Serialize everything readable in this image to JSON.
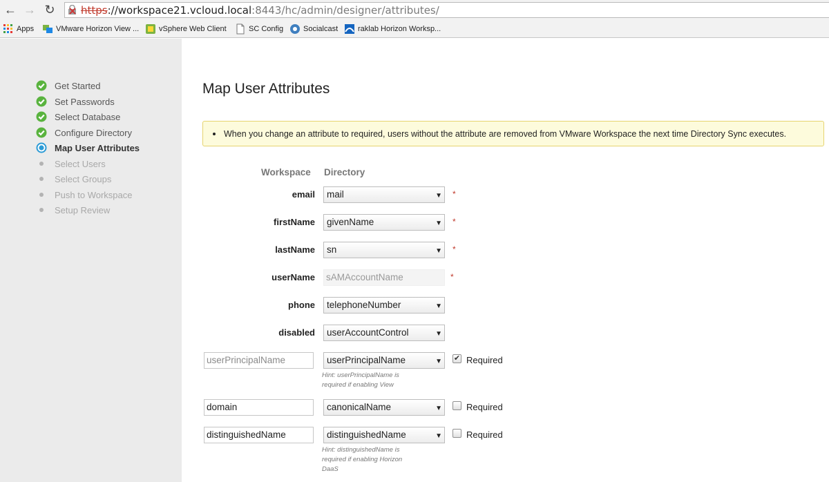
{
  "browser": {
    "url_scheme": "https",
    "url_host": "://workspace21.vcloud.local",
    "url_rest": ":8443/hc/admin/designer/attributes/",
    "bookmarks": [
      "Apps",
      "VMware Horizon View ...",
      "vSphere Web Client",
      "SC Config",
      "Socialcast",
      "raklab Horizon Worksp..."
    ]
  },
  "sidebar": {
    "steps": [
      {
        "label": "Get Started",
        "state": "done"
      },
      {
        "label": "Set Passwords",
        "state": "done"
      },
      {
        "label": "Select Database",
        "state": "done"
      },
      {
        "label": "Configure Directory",
        "state": "done"
      },
      {
        "label": "Map User Attributes",
        "state": "active"
      },
      {
        "label": "Select Users",
        "state": "pending"
      },
      {
        "label": "Select Groups",
        "state": "pending"
      },
      {
        "label": "Push to Workspace",
        "state": "pending"
      },
      {
        "label": "Setup Review",
        "state": "pending"
      }
    ]
  },
  "main": {
    "title": "Map User Attributes",
    "notice": "When you change an attribute to required, users without the attribute are removed from VMware Workspace the next time Directory Sync executes.",
    "col_workspace": "Workspace",
    "col_directory": "Directory",
    "required_mark": "*",
    "fixed_rows": [
      {
        "label": "email",
        "value": "mail"
      },
      {
        "label": "firstName",
        "value": "givenName"
      },
      {
        "label": "lastName",
        "value": "sn"
      },
      {
        "label": "userName",
        "value": "sAMAccountName"
      },
      {
        "label": "phone",
        "value": "telephoneNumber"
      },
      {
        "label": "disabled",
        "value": "userAccountControl"
      }
    ],
    "custom_rows": [
      {
        "workspace": "userPrincipalName",
        "value": "userPrincipalName",
        "required": true,
        "required_label": "Required",
        "hint": "Hint: userPrincipalName is required if enabling View"
      },
      {
        "workspace": "domain",
        "value": "canonicalName",
        "required": false,
        "required_label": "Required"
      },
      {
        "workspace": "distinguishedName",
        "value": "distinguishedName",
        "required": false,
        "required_label": "Required",
        "hint": "Hint: distinguishedName is required if enabling Horizon DaaS"
      }
    ]
  }
}
